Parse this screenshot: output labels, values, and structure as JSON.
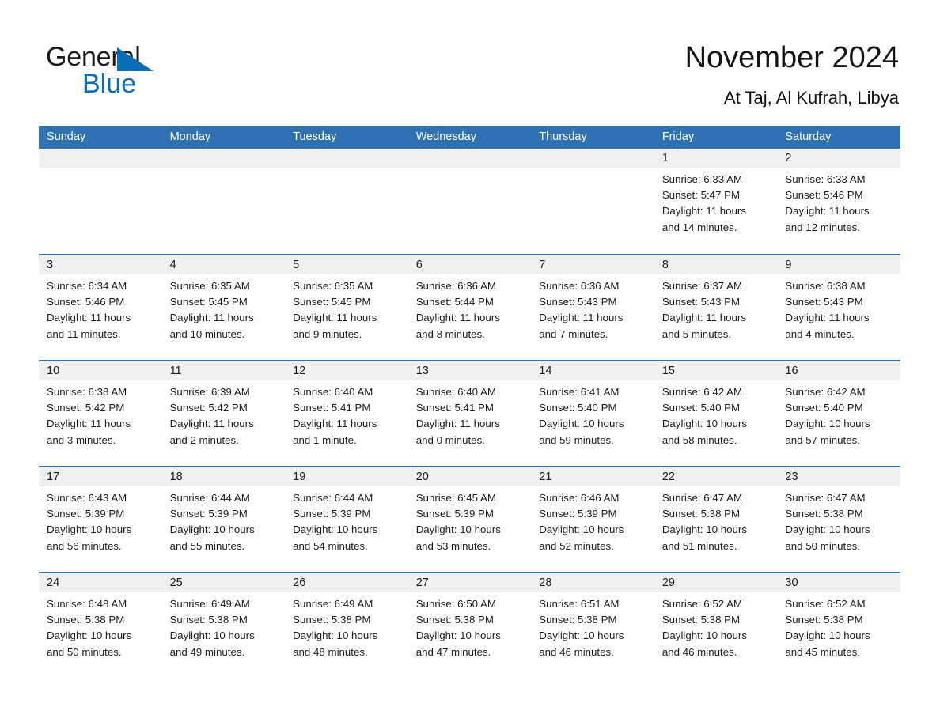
{
  "brand": {
    "name_part1": "General",
    "name_part2": "Blue",
    "triangle_color": "#0b6cb8",
    "accent_color": "#2f72b4"
  },
  "header": {
    "title": "November 2024",
    "subtitle": "At Taj, Al Kufrah, Libya"
  },
  "calendar": {
    "weekday_headers": [
      "Sunday",
      "Monday",
      "Tuesday",
      "Wednesday",
      "Thursday",
      "Friday",
      "Saturday"
    ],
    "weeks": [
      [
        {
          "day": "",
          "sunrise": "",
          "sunset": "",
          "daylight_line1": "",
          "daylight_line2": ""
        },
        {
          "day": "",
          "sunrise": "",
          "sunset": "",
          "daylight_line1": "",
          "daylight_line2": ""
        },
        {
          "day": "",
          "sunrise": "",
          "sunset": "",
          "daylight_line1": "",
          "daylight_line2": ""
        },
        {
          "day": "",
          "sunrise": "",
          "sunset": "",
          "daylight_line1": "",
          "daylight_line2": ""
        },
        {
          "day": "",
          "sunrise": "",
          "sunset": "",
          "daylight_line1": "",
          "daylight_line2": ""
        },
        {
          "day": "1",
          "sunrise": "Sunrise: 6:33 AM",
          "sunset": "Sunset: 5:47 PM",
          "daylight_line1": "Daylight: 11 hours",
          "daylight_line2": "and 14 minutes."
        },
        {
          "day": "2",
          "sunrise": "Sunrise: 6:33 AM",
          "sunset": "Sunset: 5:46 PM",
          "daylight_line1": "Daylight: 11 hours",
          "daylight_line2": "and 12 minutes."
        }
      ],
      [
        {
          "day": "3",
          "sunrise": "Sunrise: 6:34 AM",
          "sunset": "Sunset: 5:46 PM",
          "daylight_line1": "Daylight: 11 hours",
          "daylight_line2": "and 11 minutes."
        },
        {
          "day": "4",
          "sunrise": "Sunrise: 6:35 AM",
          "sunset": "Sunset: 5:45 PM",
          "daylight_line1": "Daylight: 11 hours",
          "daylight_line2": "and 10 minutes."
        },
        {
          "day": "5",
          "sunrise": "Sunrise: 6:35 AM",
          "sunset": "Sunset: 5:45 PM",
          "daylight_line1": "Daylight: 11 hours",
          "daylight_line2": "and 9 minutes."
        },
        {
          "day": "6",
          "sunrise": "Sunrise: 6:36 AM",
          "sunset": "Sunset: 5:44 PM",
          "daylight_line1": "Daylight: 11 hours",
          "daylight_line2": "and 8 minutes."
        },
        {
          "day": "7",
          "sunrise": "Sunrise: 6:36 AM",
          "sunset": "Sunset: 5:43 PM",
          "daylight_line1": "Daylight: 11 hours",
          "daylight_line2": "and 7 minutes."
        },
        {
          "day": "8",
          "sunrise": "Sunrise: 6:37 AM",
          "sunset": "Sunset: 5:43 PM",
          "daylight_line1": "Daylight: 11 hours",
          "daylight_line2": "and 5 minutes."
        },
        {
          "day": "9",
          "sunrise": "Sunrise: 6:38 AM",
          "sunset": "Sunset: 5:43 PM",
          "daylight_line1": "Daylight: 11 hours",
          "daylight_line2": "and 4 minutes."
        }
      ],
      [
        {
          "day": "10",
          "sunrise": "Sunrise: 6:38 AM",
          "sunset": "Sunset: 5:42 PM",
          "daylight_line1": "Daylight: 11 hours",
          "daylight_line2": "and 3 minutes."
        },
        {
          "day": "11",
          "sunrise": "Sunrise: 6:39 AM",
          "sunset": "Sunset: 5:42 PM",
          "daylight_line1": "Daylight: 11 hours",
          "daylight_line2": "and 2 minutes."
        },
        {
          "day": "12",
          "sunrise": "Sunrise: 6:40 AM",
          "sunset": "Sunset: 5:41 PM",
          "daylight_line1": "Daylight: 11 hours",
          "daylight_line2": "and 1 minute."
        },
        {
          "day": "13",
          "sunrise": "Sunrise: 6:40 AM",
          "sunset": "Sunset: 5:41 PM",
          "daylight_line1": "Daylight: 11 hours",
          "daylight_line2": "and 0 minutes."
        },
        {
          "day": "14",
          "sunrise": "Sunrise: 6:41 AM",
          "sunset": "Sunset: 5:40 PM",
          "daylight_line1": "Daylight: 10 hours",
          "daylight_line2": "and 59 minutes."
        },
        {
          "day": "15",
          "sunrise": "Sunrise: 6:42 AM",
          "sunset": "Sunset: 5:40 PM",
          "daylight_line1": "Daylight: 10 hours",
          "daylight_line2": "and 58 minutes."
        },
        {
          "day": "16",
          "sunrise": "Sunrise: 6:42 AM",
          "sunset": "Sunset: 5:40 PM",
          "daylight_line1": "Daylight: 10 hours",
          "daylight_line2": "and 57 minutes."
        }
      ],
      [
        {
          "day": "17",
          "sunrise": "Sunrise: 6:43 AM",
          "sunset": "Sunset: 5:39 PM",
          "daylight_line1": "Daylight: 10 hours",
          "daylight_line2": "and 56 minutes."
        },
        {
          "day": "18",
          "sunrise": "Sunrise: 6:44 AM",
          "sunset": "Sunset: 5:39 PM",
          "daylight_line1": "Daylight: 10 hours",
          "daylight_line2": "and 55 minutes."
        },
        {
          "day": "19",
          "sunrise": "Sunrise: 6:44 AM",
          "sunset": "Sunset: 5:39 PM",
          "daylight_line1": "Daylight: 10 hours",
          "daylight_line2": "and 54 minutes."
        },
        {
          "day": "20",
          "sunrise": "Sunrise: 6:45 AM",
          "sunset": "Sunset: 5:39 PM",
          "daylight_line1": "Daylight: 10 hours",
          "daylight_line2": "and 53 minutes."
        },
        {
          "day": "21",
          "sunrise": "Sunrise: 6:46 AM",
          "sunset": "Sunset: 5:39 PM",
          "daylight_line1": "Daylight: 10 hours",
          "daylight_line2": "and 52 minutes."
        },
        {
          "day": "22",
          "sunrise": "Sunrise: 6:47 AM",
          "sunset": "Sunset: 5:38 PM",
          "daylight_line1": "Daylight: 10 hours",
          "daylight_line2": "and 51 minutes."
        },
        {
          "day": "23",
          "sunrise": "Sunrise: 6:47 AM",
          "sunset": "Sunset: 5:38 PM",
          "daylight_line1": "Daylight: 10 hours",
          "daylight_line2": "and 50 minutes."
        }
      ],
      [
        {
          "day": "24",
          "sunrise": "Sunrise: 6:48 AM",
          "sunset": "Sunset: 5:38 PM",
          "daylight_line1": "Daylight: 10 hours",
          "daylight_line2": "and 50 minutes."
        },
        {
          "day": "25",
          "sunrise": "Sunrise: 6:49 AM",
          "sunset": "Sunset: 5:38 PM",
          "daylight_line1": "Daylight: 10 hours",
          "daylight_line2": "and 49 minutes."
        },
        {
          "day": "26",
          "sunrise": "Sunrise: 6:49 AM",
          "sunset": "Sunset: 5:38 PM",
          "daylight_line1": "Daylight: 10 hours",
          "daylight_line2": "and 48 minutes."
        },
        {
          "day": "27",
          "sunrise": "Sunrise: 6:50 AM",
          "sunset": "Sunset: 5:38 PM",
          "daylight_line1": "Daylight: 10 hours",
          "daylight_line2": "and 47 minutes."
        },
        {
          "day": "28",
          "sunrise": "Sunrise: 6:51 AM",
          "sunset": "Sunset: 5:38 PM",
          "daylight_line1": "Daylight: 10 hours",
          "daylight_line2": "and 46 minutes."
        },
        {
          "day": "29",
          "sunrise": "Sunrise: 6:52 AM",
          "sunset": "Sunset: 5:38 PM",
          "daylight_line1": "Daylight: 10 hours",
          "daylight_line2": "and 46 minutes."
        },
        {
          "day": "30",
          "sunrise": "Sunrise: 6:52 AM",
          "sunset": "Sunset: 5:38 PM",
          "daylight_line1": "Daylight: 10 hours",
          "daylight_line2": "and 45 minutes."
        }
      ]
    ]
  }
}
